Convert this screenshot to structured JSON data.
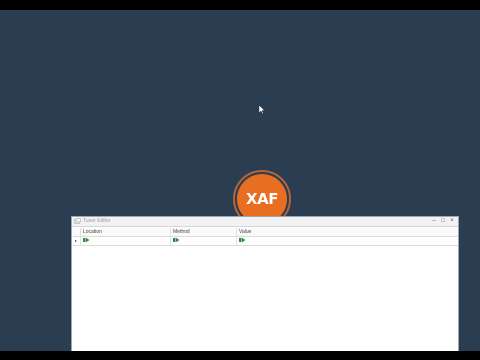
{
  "window": {
    "title": "Tuner Editor",
    "controls": {
      "minimize": "–",
      "maximize": "□",
      "close": "×"
    }
  },
  "logo": {
    "text": "XAF"
  },
  "grid": {
    "columns": [
      "Location",
      "Method",
      "Value"
    ],
    "new_row_indicator": "▸"
  },
  "colors": {
    "desktop": "#2b3e51",
    "logo": "#e86e22",
    "editor_icon": "#2e8b3a"
  },
  "icons": {
    "cursor": "mouse-pointer-icon",
    "title": "window-app-icon",
    "cell_editor": "green-editor-icon"
  }
}
